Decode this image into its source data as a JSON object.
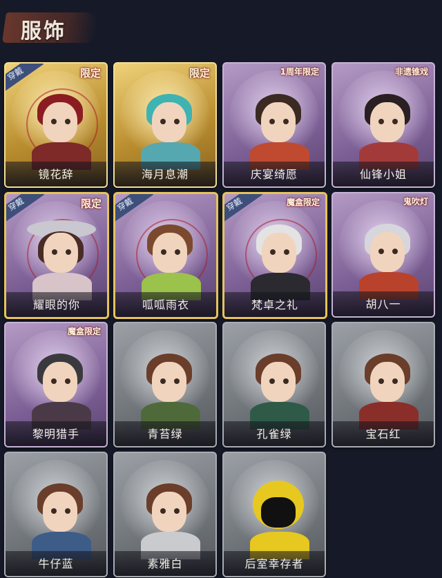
{
  "header": {
    "title": "服饰"
  },
  "outfits": [
    {
      "name": "镜花辞",
      "tag": "限定",
      "worn": "穿戴",
      "theme": "gold"
    },
    {
      "name": "海月息潮",
      "tag": "限定",
      "worn": "",
      "theme": "gold"
    },
    {
      "name": "庆宴绮愿",
      "tag": "1周年限定",
      "worn": "",
      "theme": "purple"
    },
    {
      "name": "仙锋小姐",
      "tag": "非遗锥戏",
      "worn": "",
      "theme": "purple"
    },
    {
      "name": "耀眼的你",
      "tag": "限定",
      "worn": "穿戴",
      "theme": "purple"
    },
    {
      "name": "呱呱雨衣",
      "tag": "",
      "worn": "穿戴",
      "theme": "purple"
    },
    {
      "name": "梵卓之礼",
      "tag": "魔盒限定",
      "worn": "穿戴",
      "theme": "purple"
    },
    {
      "name": "胡八一",
      "tag": "鬼吹灯",
      "worn": "",
      "theme": "purple"
    },
    {
      "name": "黎明猎手",
      "tag": "魔盒限定",
      "worn": "",
      "theme": "purple"
    },
    {
      "name": "青苔绿",
      "tag": "",
      "worn": "",
      "theme": "gray"
    },
    {
      "name": "孔雀绿",
      "tag": "",
      "worn": "",
      "theme": "gray"
    },
    {
      "name": "宝石红",
      "tag": "",
      "worn": "",
      "theme": "gray"
    },
    {
      "name": "牛仔蓝",
      "tag": "",
      "worn": "",
      "theme": "gray"
    },
    {
      "name": "素雅白",
      "tag": "",
      "worn": "",
      "theme": "gray"
    },
    {
      "name": "后室幸存者",
      "tag": "",
      "worn": "",
      "theme": "gray"
    }
  ],
  "colors": {
    "background": "#161a28",
    "gold_card": "#d7b04f",
    "purple_card": "#8f72a8",
    "gray_card": "#7d8288",
    "worn_badge": "#3d4f7a"
  }
}
